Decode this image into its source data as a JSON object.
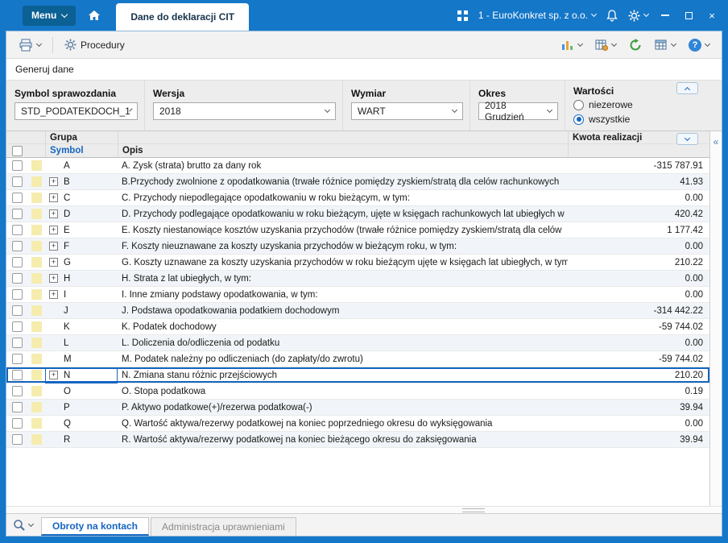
{
  "titlebar": {
    "menu_label": "Menu",
    "tab_label": "Dane do deklaracji CIT",
    "company_label": "1 - EuroKonkret sp. z o.o."
  },
  "toolbar": {
    "procedures_label": "Procedury",
    "help_glyph": "?"
  },
  "panel": {
    "generate_label": "Generuj dane"
  },
  "filters": [
    {
      "label": "Symbol sprawozdania",
      "value": "STD_PODATEKDOCH_1"
    },
    {
      "label": "Wersja",
      "value": "2018"
    },
    {
      "label": "Wymiar",
      "value": "WART"
    },
    {
      "label": "Okres",
      "value": "2018 Grudzień"
    }
  ],
  "values_filter": {
    "label": "Wartości",
    "options": [
      {
        "label": "niezerowe",
        "selected": false
      },
      {
        "label": "wszystkie",
        "selected": true
      }
    ]
  },
  "table": {
    "headers": {
      "grupa": "Grupa",
      "symbol": "Symbol",
      "opis": "Opis",
      "kwota": "Kwota realizacji"
    },
    "rows": [
      {
        "symbol": "A",
        "expand": false,
        "selected": false,
        "opis": "A. Zysk (strata) brutto za dany rok",
        "kwota": "-315 787.91"
      },
      {
        "symbol": "B",
        "expand": true,
        "selected": false,
        "opis": "B.Przychody zwolnione z opodatkowania (trwałe różnice pomiędzy zyskiem/stratą dla celów rachunkowych",
        "kwota": "41.93"
      },
      {
        "symbol": "C",
        "expand": true,
        "selected": false,
        "opis": "C. Przychody niepodlegające opodatkowaniu w roku bieżącym, w tym:",
        "kwota": "0.00"
      },
      {
        "symbol": "D",
        "expand": true,
        "selected": false,
        "opis": "D. Przychody podlegające opodatkowaniu w roku bieżącym, ujęte w księgach rachunkowych lat ubiegłych w",
        "kwota": "420.42"
      },
      {
        "symbol": "E",
        "expand": true,
        "selected": false,
        "opis": "E. Koszty niestanowiące kosztów uzyskania przychodów (trwałe różnice pomiędzy zyskiem/stratą dla celów",
        "kwota": "1 177.42"
      },
      {
        "symbol": "F",
        "expand": true,
        "selected": false,
        "opis": "F. Koszty nieuznawane za koszty uzyskania przychodów w bieżącym roku, w tym:",
        "kwota": "0.00"
      },
      {
        "symbol": "G",
        "expand": true,
        "selected": false,
        "opis": "G. Koszty uznawane za koszty uzyskania przychodów w roku bieżącym ujęte w księgach lat ubiegłych, w tym",
        "kwota": "210.22"
      },
      {
        "symbol": "H",
        "expand": true,
        "selected": false,
        "opis": "H. Strata z lat ubiegłych, w tym:",
        "kwota": "0.00"
      },
      {
        "symbol": "I",
        "expand": true,
        "selected": false,
        "opis": "I. Inne zmiany podstawy opodatkowania, w tym:",
        "kwota": "0.00"
      },
      {
        "symbol": "J",
        "expand": false,
        "selected": false,
        "opis": "J. Podstawa opodatkowania podatkiem dochodowym",
        "kwota": "-314 442.22"
      },
      {
        "symbol": "K",
        "expand": false,
        "selected": false,
        "opis": "K. Podatek dochodowy",
        "kwota": "-59 744.02"
      },
      {
        "symbol": "L",
        "expand": false,
        "selected": false,
        "opis": "L. Doliczenia do/odliczenia od podatku",
        "kwota": "0.00"
      },
      {
        "symbol": "M",
        "expand": false,
        "selected": false,
        "opis": "M. Podatek należny po odliczeniach (do zapłaty/do zwrotu)",
        "kwota": "-59 744.02"
      },
      {
        "symbol": "N",
        "expand": true,
        "selected": true,
        "opis": "N. Zmiana stanu różnic przejściowych",
        "kwota": "210.20"
      },
      {
        "symbol": "O",
        "expand": false,
        "selected": false,
        "opis": "O. Stopa podatkowa",
        "kwota": "0.19"
      },
      {
        "symbol": "P",
        "expand": false,
        "selected": false,
        "opis": "P. Aktywo podatkowe(+)/rezerwa podatkowa(-)",
        "kwota": "39.94"
      },
      {
        "symbol": "Q",
        "expand": false,
        "selected": false,
        "opis": "Q. Wartość aktywa/rezerwy podatkowej na koniec poprzedniego okresu do wyksięgowania",
        "kwota": "0.00"
      },
      {
        "symbol": "R",
        "expand": false,
        "selected": false,
        "opis": "R. Wartość aktywa/rezerwy podatkowej na koniec bieżącego okresu do zaksięgowania",
        "kwota": "39.94"
      }
    ]
  },
  "bottom": {
    "tabs": [
      {
        "label": "Obroty na kontach",
        "active": true
      },
      {
        "label": "Administracja uprawnieniami",
        "active": false
      }
    ]
  },
  "colors": {
    "accent": "#1565c0",
    "frame_blue": "#1577c8",
    "menu_button_blue": "#0b6094",
    "refresh_green": "#3f9d3f",
    "row_indicator_yellow": "#f5ecae",
    "alt_row": "#f1f5f9"
  }
}
